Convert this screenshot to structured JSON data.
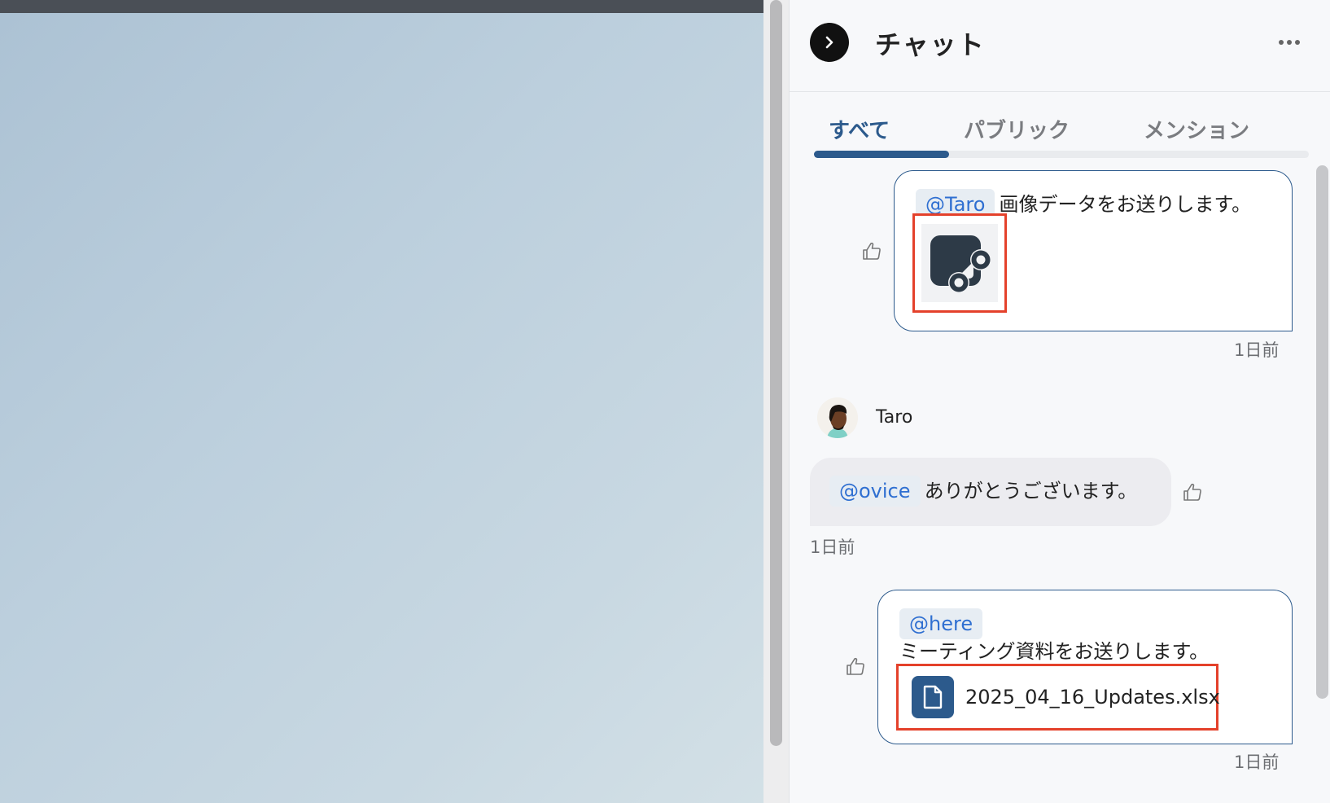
{
  "header": {
    "title": "チャット",
    "collapse_icon": "chevron-right-icon",
    "more_icon": "more-horizontal-icon"
  },
  "tabs": [
    {
      "label": "すべて",
      "active": true
    },
    {
      "label": "パブリック",
      "active": false
    },
    {
      "label": "メンション",
      "active": false
    }
  ],
  "messages": [
    {
      "direction": "outgoing",
      "mention": "@Taro",
      "text": "画像データをお送りします。",
      "attachment": {
        "type": "image",
        "icon": "image-placeholder-icon"
      },
      "time": "1日前"
    },
    {
      "direction": "incoming",
      "sender": "Taro",
      "mention": "@ovice",
      "text": "ありがとうございます。",
      "time": "1日前"
    },
    {
      "direction": "outgoing",
      "mention": "@here",
      "text": "ミーティング資料をお送りします。",
      "attachment": {
        "type": "file",
        "name": "2025_04_16_Updates.xlsx",
        "icon": "file-icon"
      },
      "time": "1日前"
    }
  ],
  "colors": {
    "accent": "#2c5a8c",
    "mention_text": "#2f6fd1",
    "highlight": "#e4412b"
  }
}
